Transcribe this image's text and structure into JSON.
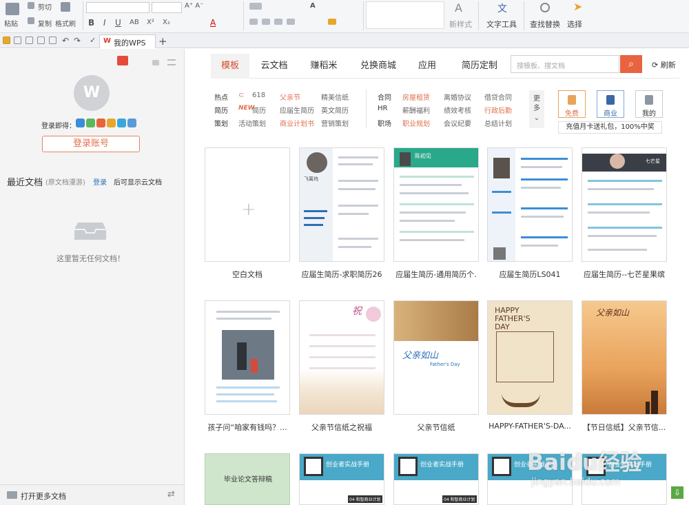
{
  "ribbon": {
    "paste": "粘贴",
    "cut": "剪切",
    "copy": "复制",
    "format_painter": "格式刷",
    "style_new": "新样式",
    "text_tools": "文字工具",
    "find_replace": "查找替换",
    "select": "选择",
    "bold": "B",
    "italic": "I",
    "underline": "U",
    "strike": "AB",
    "superscript": "X²",
    "subscript": "X₂"
  },
  "doc_tab": {
    "label": "我的WPS",
    "add": "+"
  },
  "sidebar": {
    "logo_letter": "W",
    "promo_label": "登录即得：",
    "login_button": "登录账号",
    "recent_title": "最近文档",
    "recent_sub": "(原文档漫游)",
    "recent_login": "登录",
    "recent_tip": "后可显示云文档",
    "empty_text": "这里暂无任何文档！",
    "more_docs": "打开更多文档"
  },
  "tabs": [
    "模板",
    "云文档",
    "赚稻米",
    "兑换商城",
    "应用",
    "简历定制"
  ],
  "active_tab": 0,
  "search": {
    "placeholder": "搜模板、搜文档",
    "refresh": "刷新"
  },
  "categories": {
    "row1": {
      "key": "热点",
      "items": [
        "618",
        "父亲节",
        "精美信纸"
      ]
    },
    "row2": {
      "key": "简历",
      "items": [
        "简历",
        "应届生简历",
        "英文简历"
      ],
      "badge": "NEW"
    },
    "row3": {
      "key": "策划",
      "items": [
        "活动策划",
        "商业计划书",
        "营销策划"
      ]
    },
    "row4": {
      "key": "合同",
      "items": [
        "房屋租赁",
        "离婚协议",
        "借贷合同"
      ]
    },
    "row5": {
      "key": "HR",
      "items": [
        "薪酬福利",
        "绩效考核",
        "行政后勤"
      ]
    },
    "row6": {
      "key": "职场",
      "items": [
        "职业规划",
        "会议纪要",
        "总结计划"
      ]
    },
    "more": "更多"
  },
  "shortcuts": [
    "免费",
    "商业",
    "我的"
  ],
  "promo_banner": "充值月卡送礼包，100%中奖",
  "templates": [
    "空白文档",
    "应届生简历-求职简历26",
    "应届生简历-通用简历个.",
    "应届生简历LS041",
    "应届生简历--七芒星果缤",
    "孩子问“咱家有钱吗？...",
    "父亲节信纸之祝福",
    "父亲节信纸",
    "HAPPY-FATHER'S-DA...",
    "【节日信纸】父亲节信..."
  ],
  "card_texts": {
    "resume_name_1": "飞离坞",
    "resume_name_2": "陈初见",
    "resume_name_5": "七芒星",
    "fathers_day": "父亲如山",
    "fathers_day_en": "Father's Day",
    "happy_fathers": "HAPPY FATHER'S DAY",
    "festival_title": "父亲如山",
    "thesis": "毕业论文答辩稿",
    "startup": "创业者实战手册",
    "startup_sub": "04 和智商业计划"
  },
  "watermark": {
    "brand": "Baidu经验",
    "url": "jingyan.baidu.com"
  },
  "colors": {
    "accent": "#e8633f",
    "active_tab_text": "#d84a2b",
    "link_blue": "#2b6fb6"
  }
}
